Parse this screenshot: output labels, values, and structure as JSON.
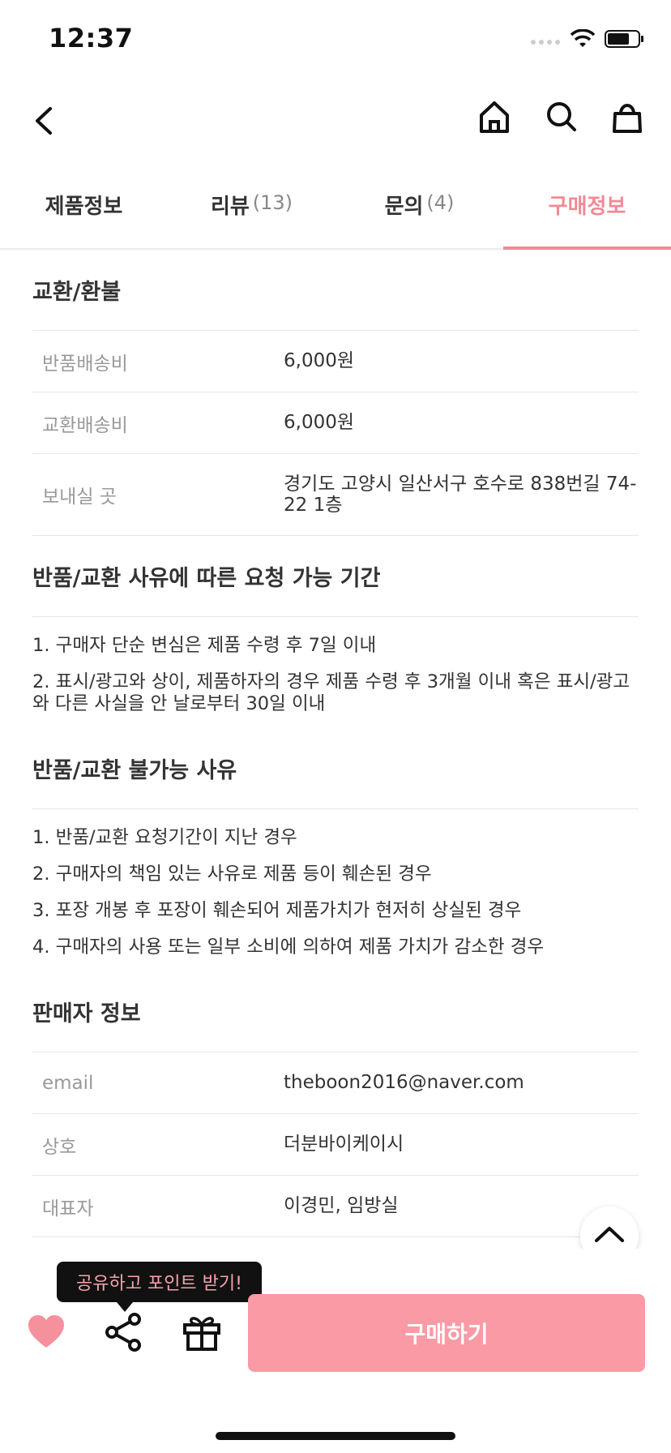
{
  "status_bar": {
    "time": "12:37"
  },
  "tabs": [
    {
      "label": "제품정보",
      "count": ""
    },
    {
      "label": "리뷰",
      "count": "(13)"
    },
    {
      "label": "문의",
      "count": "(4)"
    },
    {
      "label": "구매정보",
      "count": ""
    }
  ],
  "exchange_refund": {
    "title": "교환/환불",
    "rows": [
      {
        "label": "반품배송비",
        "value": "6,000원"
      },
      {
        "label": "교환배송비",
        "value": "6,000원"
      },
      {
        "label": "보내실 곳",
        "value": "경기도 고양시 일산서구 호수로 838번길 74-22 1층"
      }
    ]
  },
  "request_period": {
    "title": "반품/교환 사유에 따른 요청 가능 기간",
    "items": [
      "1. 구매자 단순 변심은 제품 수령 후 7일 이내",
      "2. 표시/광고와 상이, 제품하자의 경우 제품 수령 후 3개월 이내 혹은 표시/광고와 다른 사실을 안 날로부터 30일 이내"
    ]
  },
  "not_allowed": {
    "title": "반품/교환 불가능 사유",
    "items": [
      "1. 반품/교환 요청기간이 지난 경우",
      "2. 구매자의 책임 있는 사유로 제품 등이 훼손된 경우",
      "3. 포장 개봉 후 포장이 훼손되어 제품가치가 현저히 상실된 경우",
      "4. 구매자의 사용 또는 일부 소비에 의하여 제품 가치가 감소한 경우"
    ]
  },
  "seller": {
    "title": "판매자 정보",
    "rows": [
      {
        "label": "email",
        "value": "theboon2016@naver.com"
      },
      {
        "label": "상호",
        "value": "더분바이케이시"
      },
      {
        "label": "대표자",
        "value": "이경민, 임방실"
      }
    ]
  },
  "bottom_bar": {
    "tooltip": "공유하고 포인트 받기!",
    "buy_label": "구매하기"
  },
  "colors": {
    "accent": "#f08a96",
    "buy_button": "#f99aa5",
    "heart": "#f5919c"
  },
  "icons": [
    "back-icon",
    "home-icon",
    "search-icon",
    "bag-icon",
    "chevron-up-icon",
    "heart-icon",
    "share-icon",
    "gift-icon"
  ]
}
